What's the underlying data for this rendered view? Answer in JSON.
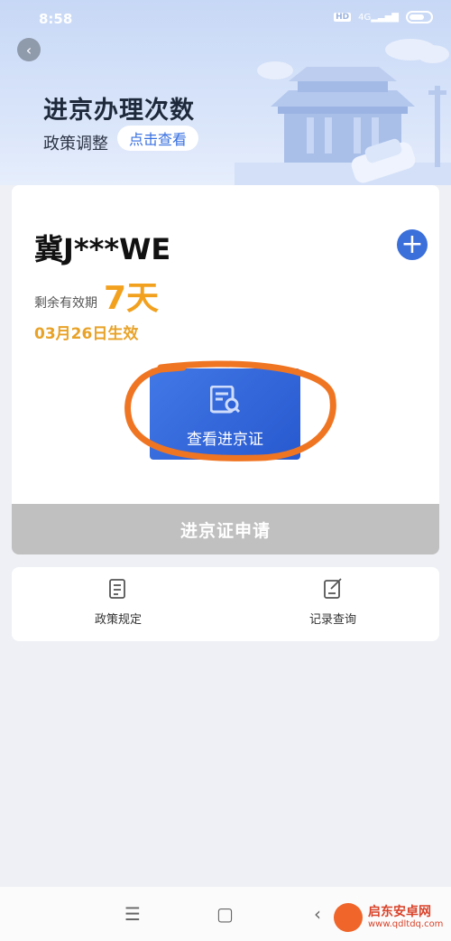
{
  "status_bar": {
    "time": "8:58",
    "network": "4G",
    "hd": "HD"
  },
  "header": {
    "title": "进京办理次数",
    "subtitle": "政策调整",
    "link_label": "点击查看"
  },
  "vehicle": {
    "plate": "冀J***WE",
    "remaining_label": "剩余有效期",
    "remaining_days": "7天",
    "effective_date": "03月26日生效"
  },
  "actions": {
    "view_permit": "查看进京证",
    "apply_permit": "进京证申请"
  },
  "shortcuts": [
    {
      "label": "政策规定",
      "icon": "document-icon"
    },
    {
      "label": "记录查询",
      "icon": "edit-record-icon"
    }
  ],
  "watermark": {
    "name": "启东安卓网",
    "url": "www.qdltdq.com"
  },
  "colors": {
    "accent": "#3b6fd9",
    "highlight": "#f2a11f",
    "annotation": "#f07522"
  }
}
